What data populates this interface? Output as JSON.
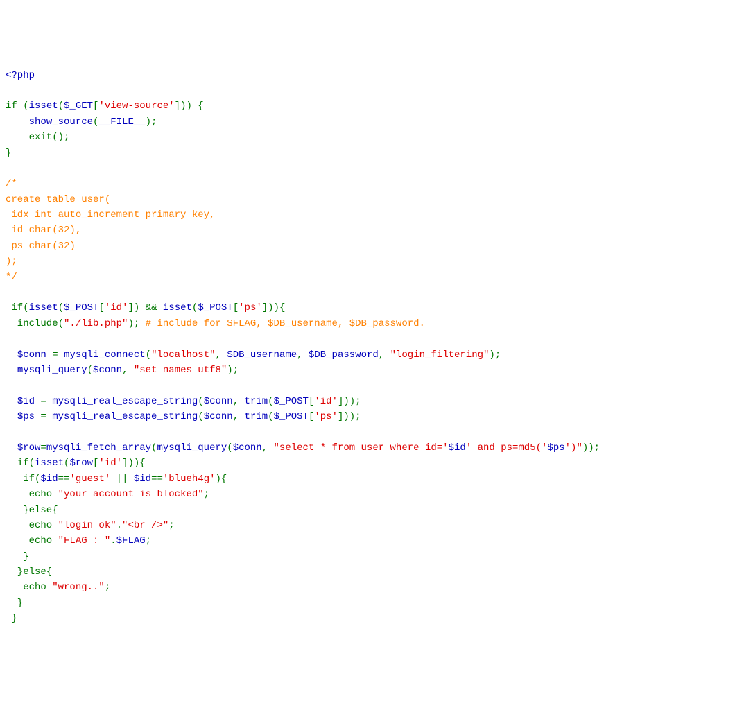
{
  "tokens": [
    {
      "t": "<?php",
      "c": "php-tag"
    },
    {
      "t": "\n\n",
      "c": "default"
    },
    {
      "t": "if (",
      "c": "keyword"
    },
    {
      "t": "isset",
      "c": "const"
    },
    {
      "t": "(",
      "c": "keyword"
    },
    {
      "t": "$_GET",
      "c": "variable"
    },
    {
      "t": "[",
      "c": "keyword"
    },
    {
      "t": "'view-source'",
      "c": "string"
    },
    {
      "t": "])) {\n    ",
      "c": "keyword"
    },
    {
      "t": "show_source",
      "c": "const"
    },
    {
      "t": "(",
      "c": "keyword"
    },
    {
      "t": "__FILE__",
      "c": "const"
    },
    {
      "t": ");\n    exit();\n}\n\n",
      "c": "keyword"
    },
    {
      "t": "/*\ncreate table user(\n idx int auto_increment primary key,\n id char(32),\n ps char(32)\n);\n*/",
      "c": "comment"
    },
    {
      "t": "\n\n if(",
      "c": "keyword"
    },
    {
      "t": "isset",
      "c": "const"
    },
    {
      "t": "(",
      "c": "keyword"
    },
    {
      "t": "$_POST",
      "c": "variable"
    },
    {
      "t": "[",
      "c": "keyword"
    },
    {
      "t": "'id'",
      "c": "string"
    },
    {
      "t": "]) && ",
      "c": "keyword"
    },
    {
      "t": "isset",
      "c": "const"
    },
    {
      "t": "(",
      "c": "keyword"
    },
    {
      "t": "$_POST",
      "c": "variable"
    },
    {
      "t": "[",
      "c": "keyword"
    },
    {
      "t": "'ps'",
      "c": "string"
    },
    {
      "t": "])){\n  include(",
      "c": "keyword"
    },
    {
      "t": "\"./lib.php\"",
      "c": "string"
    },
    {
      "t": "); ",
      "c": "keyword"
    },
    {
      "t": "# include for $FLAG, $DB_username, $DB_password.",
      "c": "comment"
    },
    {
      "t": "\n\n  ",
      "c": "keyword"
    },
    {
      "t": "$conn ",
      "c": "variable"
    },
    {
      "t": "= ",
      "c": "keyword"
    },
    {
      "t": "mysqli_connect",
      "c": "const"
    },
    {
      "t": "(",
      "c": "keyword"
    },
    {
      "t": "\"localhost\"",
      "c": "string"
    },
    {
      "t": ", ",
      "c": "keyword"
    },
    {
      "t": "$DB_username",
      "c": "variable"
    },
    {
      "t": ", ",
      "c": "keyword"
    },
    {
      "t": "$DB_password",
      "c": "variable"
    },
    {
      "t": ", ",
      "c": "keyword"
    },
    {
      "t": "\"login_filtering\"",
      "c": "string"
    },
    {
      "t": ");\n  ",
      "c": "keyword"
    },
    {
      "t": "mysqli_query",
      "c": "const"
    },
    {
      "t": "(",
      "c": "keyword"
    },
    {
      "t": "$conn",
      "c": "variable"
    },
    {
      "t": ", ",
      "c": "keyword"
    },
    {
      "t": "\"set names utf8\"",
      "c": "string"
    },
    {
      "t": ");\n\n  ",
      "c": "keyword"
    },
    {
      "t": "$id ",
      "c": "variable"
    },
    {
      "t": "= ",
      "c": "keyword"
    },
    {
      "t": "mysqli_real_escape_string",
      "c": "const"
    },
    {
      "t": "(",
      "c": "keyword"
    },
    {
      "t": "$conn",
      "c": "variable"
    },
    {
      "t": ", ",
      "c": "keyword"
    },
    {
      "t": "trim",
      "c": "const"
    },
    {
      "t": "(",
      "c": "keyword"
    },
    {
      "t": "$_POST",
      "c": "variable"
    },
    {
      "t": "[",
      "c": "keyword"
    },
    {
      "t": "'id'",
      "c": "string"
    },
    {
      "t": "]));\n  ",
      "c": "keyword"
    },
    {
      "t": "$ps ",
      "c": "variable"
    },
    {
      "t": "= ",
      "c": "keyword"
    },
    {
      "t": "mysqli_real_escape_string",
      "c": "const"
    },
    {
      "t": "(",
      "c": "keyword"
    },
    {
      "t": "$conn",
      "c": "variable"
    },
    {
      "t": ", ",
      "c": "keyword"
    },
    {
      "t": "trim",
      "c": "const"
    },
    {
      "t": "(",
      "c": "keyword"
    },
    {
      "t": "$_POST",
      "c": "variable"
    },
    {
      "t": "[",
      "c": "keyword"
    },
    {
      "t": "'ps'",
      "c": "string"
    },
    {
      "t": "]));\n\n  ",
      "c": "keyword"
    },
    {
      "t": "$row",
      "c": "variable"
    },
    {
      "t": "=",
      "c": "keyword"
    },
    {
      "t": "mysqli_fetch_array",
      "c": "const"
    },
    {
      "t": "(",
      "c": "keyword"
    },
    {
      "t": "mysqli_query",
      "c": "const"
    },
    {
      "t": "(",
      "c": "keyword"
    },
    {
      "t": "$conn",
      "c": "variable"
    },
    {
      "t": ", ",
      "c": "keyword"
    },
    {
      "t": "\"select * from user where id='",
      "c": "string"
    },
    {
      "t": "$id",
      "c": "variable"
    },
    {
      "t": "' and ps=md5('",
      "c": "string"
    },
    {
      "t": "$ps",
      "c": "variable"
    },
    {
      "t": "')\"",
      "c": "string"
    },
    {
      "t": "));\n  if(",
      "c": "keyword"
    },
    {
      "t": "isset",
      "c": "const"
    },
    {
      "t": "(",
      "c": "keyword"
    },
    {
      "t": "$row",
      "c": "variable"
    },
    {
      "t": "[",
      "c": "keyword"
    },
    {
      "t": "'id'",
      "c": "string"
    },
    {
      "t": "])){\n   if(",
      "c": "keyword"
    },
    {
      "t": "$id",
      "c": "variable"
    },
    {
      "t": "==",
      "c": "keyword"
    },
    {
      "t": "'guest'",
      "c": "string"
    },
    {
      "t": " || ",
      "c": "keyword"
    },
    {
      "t": "$id",
      "c": "variable"
    },
    {
      "t": "==",
      "c": "keyword"
    },
    {
      "t": "'blueh4g'",
      "c": "string"
    },
    {
      "t": "){\n    echo ",
      "c": "keyword"
    },
    {
      "t": "\"your account is blocked\"",
      "c": "string"
    },
    {
      "t": ";\n   }else{\n    echo ",
      "c": "keyword"
    },
    {
      "t": "\"login ok\"",
      "c": "string"
    },
    {
      "t": ".",
      "c": "keyword"
    },
    {
      "t": "\"<br />\"",
      "c": "string"
    },
    {
      "t": ";\n    echo ",
      "c": "keyword"
    },
    {
      "t": "\"FLAG : \"",
      "c": "string"
    },
    {
      "t": ".",
      "c": "keyword"
    },
    {
      "t": "$FLAG",
      "c": "variable"
    },
    {
      "t": ";\n   }\n  }else{\n   echo ",
      "c": "keyword"
    },
    {
      "t": "\"wrong..\"",
      "c": "string"
    },
    {
      "t": ";\n  }\n }",
      "c": "keyword"
    }
  ]
}
